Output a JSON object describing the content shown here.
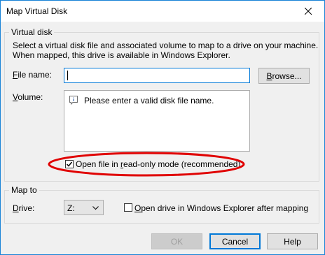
{
  "window": {
    "title": "Map Virtual Disk"
  },
  "virtual_disk": {
    "group_title": "Virtual disk",
    "description_line1": "Select a virtual disk file and associated volume to map to a drive on your machine.",
    "description_line2": "When mapped, this drive is available in Windows Explorer.",
    "file_name_label_ul": "F",
    "file_name_label_rest": "ile name:",
    "file_name_value": "",
    "browse_button_ul": "B",
    "browse_button_rest": "rowse...",
    "volume_label_ul": "V",
    "volume_label_rest": "olume:",
    "volume_message": "Please enter a valid disk file name.",
    "read_only_checked": true,
    "read_only_label_a": "Open file in ",
    "read_only_label_ul": "r",
    "read_only_label_b": "ead-only mode (recommended)"
  },
  "map_to": {
    "group_title": "Map to",
    "drive_label_ul": "D",
    "drive_label_rest": "rive:",
    "drive_value": "Z:",
    "open_explorer_checked": false,
    "open_explorer_label_ul": "O",
    "open_explorer_label_rest": "pen drive in Windows Explorer after mapping"
  },
  "buttons": {
    "ok": "OK",
    "cancel": "Cancel",
    "help": "Help"
  },
  "colors": {
    "accent": "#0078d7",
    "annotation_ring": "#e00000"
  }
}
